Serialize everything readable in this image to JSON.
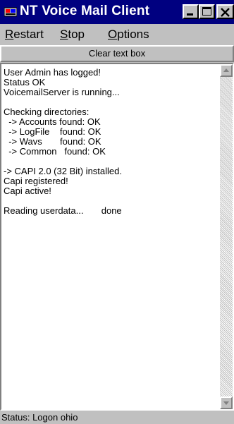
{
  "window": {
    "title": "NT Voice Mail Client",
    "icon": "voicemail-app-icon",
    "controls": [
      "minimize-icon",
      "maximize-icon",
      "close-icon"
    ]
  },
  "menu": {
    "restart": {
      "mnemonic": "R",
      "rest": "estart"
    },
    "stop": {
      "mnemonic": "S",
      "rest": "top"
    },
    "options": {
      "mnemonic": "O",
      "rest": "ptions"
    }
  },
  "clear_button": "Clear text box",
  "log": {
    "lines": [
      "User Admin has logged!",
      "Status OK",
      "VoicemailServer is running...",
      "",
      "Checking directories:",
      "  -> Accounts found: OK",
      "  -> LogFile    found: OK",
      "  -> Wavs       found: OK",
      "  -> Common   found: OK",
      "",
      "-> CAPI 2.0 (32 Bit) installed.",
      "Capi registered!",
      "Capi active!",
      "",
      "Reading userdata...       done"
    ]
  },
  "status": "Status: Logon ohio",
  "colors": {
    "titlebar": "#000080",
    "face": "#c0c0c0",
    "log_bg": "#ffffff"
  }
}
